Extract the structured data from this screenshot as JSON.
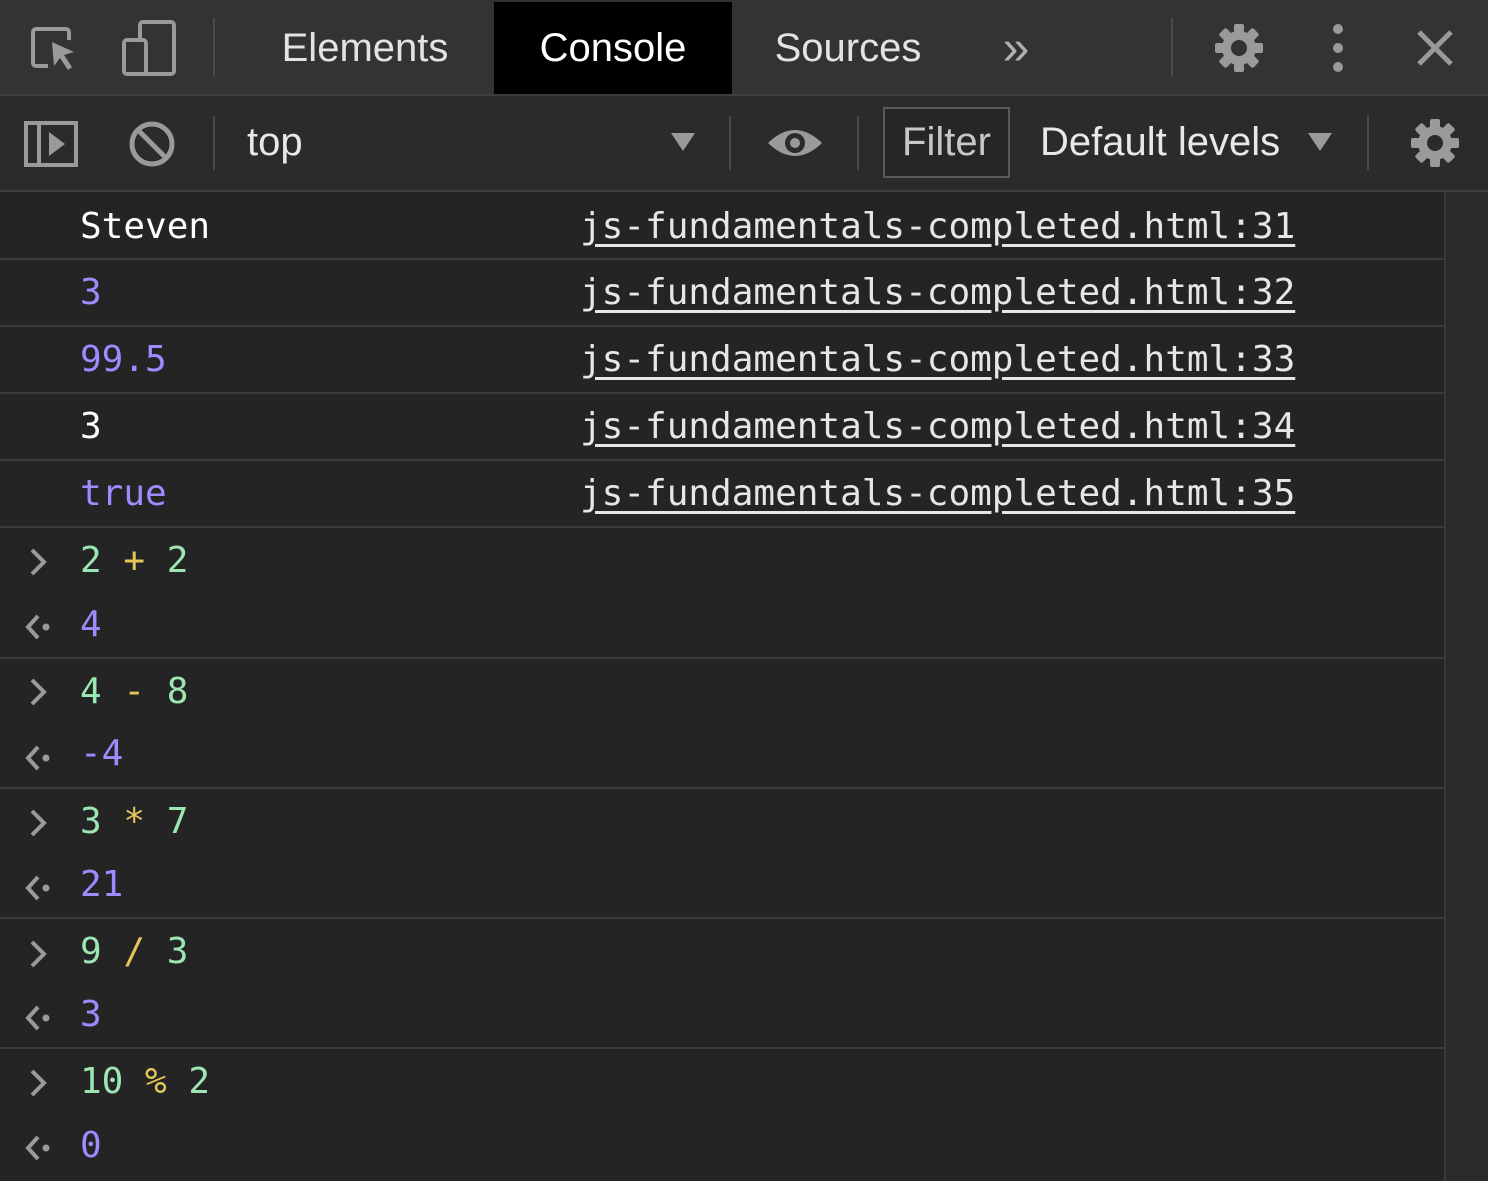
{
  "tabs": [
    {
      "label": "Elements",
      "active": false
    },
    {
      "label": "Console",
      "active": true
    },
    {
      "label": "Sources",
      "active": false
    }
  ],
  "tabbar_icons": [
    "inspect-element-icon",
    "device-toolbar-icon",
    "more-tabs-icon",
    "settings-gear-icon",
    "kebab-menu-icon",
    "close-icon"
  ],
  "more_tabs_glyph": "»",
  "toolbar": {
    "context": "top",
    "filter_placeholder": "Filter",
    "levels": "Default levels"
  },
  "logs": [
    {
      "value": "Steven",
      "type": "string",
      "source": "js-fundamentals-completed.html:31"
    },
    {
      "value": "3",
      "type": "number",
      "source": "js-fundamentals-completed.html:32"
    },
    {
      "value": "99.5",
      "type": "number",
      "source": "js-fundamentals-completed.html:33"
    },
    {
      "value": "3",
      "type": "string",
      "source": "js-fundamentals-completed.html:34"
    },
    {
      "value": "true",
      "type": "boolean",
      "source": "js-fundamentals-completed.html:35"
    }
  ],
  "evaluations": [
    {
      "left": "2",
      "op": "+",
      "right": "2",
      "result": "4"
    },
    {
      "left": "4",
      "op": "-",
      "right": "8",
      "result": "-4"
    },
    {
      "left": "3",
      "op": "*",
      "right": "7",
      "result": "21"
    },
    {
      "left": "9",
      "op": "/",
      "right": "3",
      "result": "3"
    },
    {
      "left": "10",
      "op": "%",
      "right": "2",
      "result": "0"
    }
  ],
  "colors": {
    "string": "#ffffff",
    "number": "#9b8cff",
    "input_operand": "#9ce6b4",
    "operator": "#e4c65a",
    "background": "#242424"
  }
}
